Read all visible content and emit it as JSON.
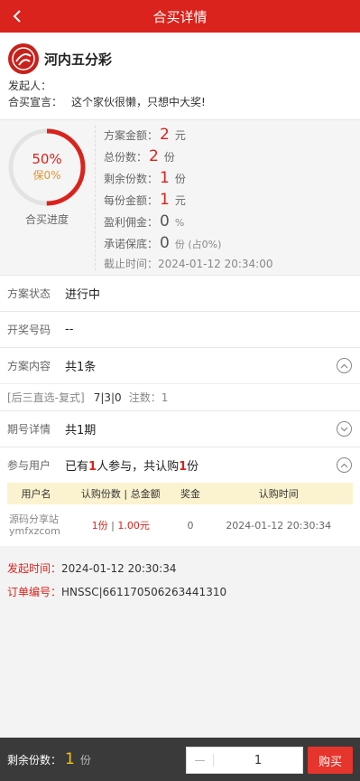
{
  "header": {
    "title": "合买详情",
    "back_icon": "chevron-left-icon"
  },
  "lottery": {
    "name": "河内五分彩",
    "initiator_label": "发起人：",
    "initiator_value": "",
    "declaration_label": "合买宣言：",
    "declaration_value": "这个家伙很懒，只想中大奖!"
  },
  "progress": {
    "percent_text": "50%",
    "percent": 0.5,
    "guarantee_text": "保0%",
    "label": "合买进度"
  },
  "stats": [
    {
      "label": "方案金额：",
      "value": "2",
      "unit": "元",
      "style": "red"
    },
    {
      "label": "总份数：",
      "value": "2",
      "unit": "份",
      "style": "red"
    },
    {
      "label": "剩余份数：",
      "value": "1",
      "unit": "份",
      "style": "red"
    },
    {
      "label": "每份金额：",
      "value": "1",
      "unit": "元",
      "style": "red"
    },
    {
      "label": "盈利佣金：",
      "value": "0",
      "unit": "%",
      "style": "gray"
    },
    {
      "label": "承诺保底：",
      "value": "0",
      "unit": "份 (占0%)",
      "style": "gray"
    }
  ],
  "deadline": {
    "label": "截止时间：",
    "value": "2024-01-12 20:34:00"
  },
  "rows": {
    "status": {
      "label": "方案状态",
      "value": "进行中"
    },
    "draw_no": {
      "label": "开奖号码",
      "value": "--"
    },
    "content": {
      "label": "方案内容",
      "value": "共1条"
    },
    "content_detail": {
      "type": "[后三直选-复式]",
      "numbers": "7|3|0",
      "notes": "注数：1"
    },
    "period": {
      "label": "期号详情",
      "value": "共1期"
    },
    "participants": {
      "label": "参与用户",
      "prefix": "已有",
      "count": "1",
      "mid": "人参与，共认购",
      "shares": "1",
      "suffix": "份"
    }
  },
  "table": {
    "headers": [
      "用户名",
      "认购份数 | 总金额",
      "奖金",
      "认购时间"
    ],
    "rows": [
      {
        "user": "源码分享站 ymfxzcom",
        "shares": "1份",
        "sep": " | ",
        "amount": "1.00元",
        "prize": "0",
        "time": "2024-01-12 20:30:34"
      }
    ]
  },
  "info": {
    "launch_label": "发起时间：",
    "launch_value": "2024-01-12 20:30:34",
    "order_label": "订单编号：",
    "order_value": "HNSSC|661170506263441310"
  },
  "footer": {
    "remaining_label": "剩余份数：",
    "remaining_value": "1",
    "remaining_unit": "份",
    "minus": "—",
    "qty": "1",
    "buy_label": "购买"
  },
  "colors": {
    "brand": "#d9231c",
    "highlight": "#f1c40f",
    "table_header": "#fbf3cf"
  }
}
